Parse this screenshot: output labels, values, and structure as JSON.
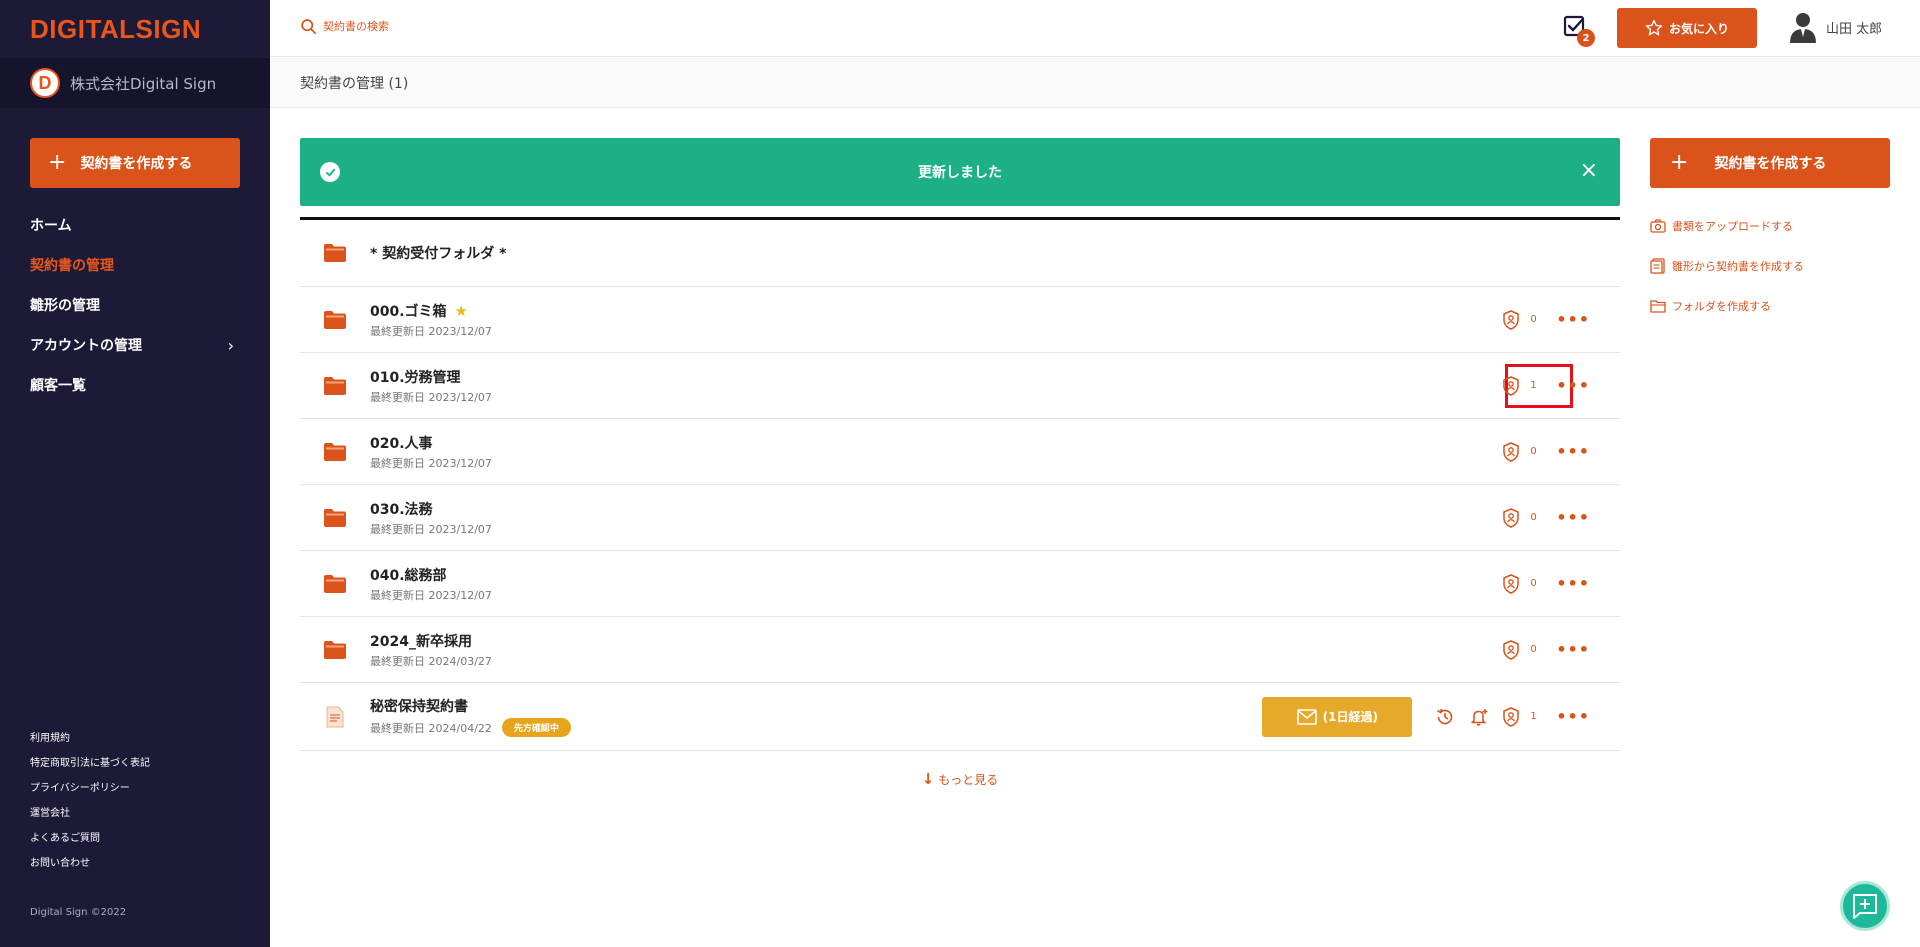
{
  "app": {
    "logo": "DIGITALSIGN",
    "company_initial": "D",
    "company_name": "株式会社Digital Sign",
    "brand_color": "#d9531a",
    "success_color": "#1db085"
  },
  "sidebar": {
    "create_label": "契約書を作成する",
    "items": [
      {
        "label": "ホーム"
      },
      {
        "label": "契約書の管理"
      },
      {
        "label": "雛形の管理"
      },
      {
        "label": "アカウントの管理"
      },
      {
        "label": "顧客一覧"
      }
    ],
    "footer_links": [
      {
        "label": "利用規約"
      },
      {
        "label": "特定商取引法に基づく表記"
      },
      {
        "label": "プライバシーポリシー"
      },
      {
        "label": "運営会社"
      },
      {
        "label": "よくあるご質問"
      },
      {
        "label": "お問い合わせ"
      }
    ],
    "copyright": "Digital Sign ©2022"
  },
  "topbar": {
    "search_placeholder": "契約書の検索",
    "task_count": "2",
    "favorites_label": "お気に入り",
    "user_name": "山田 太郎"
  },
  "breadcrumb": "契約書の管理 (1)",
  "alert": {
    "message": "更新しました",
    "close": "×"
  },
  "list": {
    "folders": [
      {
        "name": "* 契約受付フォルダ *"
      },
      {
        "name": "000.ゴミ箱",
        "starred": "★",
        "date": "最終更新日 2023/12/07",
        "count": "0"
      },
      {
        "name": "010.労務管理",
        "date": "最終更新日 2023/12/07",
        "count": "1"
      },
      {
        "name": "020.人事",
        "date": "最終更新日 2023/12/07",
        "count": "0"
      },
      {
        "name": "030.法務",
        "date": "最終更新日 2023/12/07",
        "count": "0"
      },
      {
        "name": "040.総務部",
        "date": "最終更新日 2023/12/07",
        "count": "0"
      },
      {
        "name": "2024_新卒採用",
        "date": "最終更新日 2024/03/27",
        "count": "0"
      }
    ],
    "document": {
      "name": "秘密保持契約書",
      "date": "最終更新日 2024/04/22",
      "status": "先方確認中",
      "mail_label": "(1日経過)",
      "count": "1"
    },
    "more_label": "もっと見る",
    "more_icon": "↓",
    "menu_glyph": "•••"
  },
  "right_panel": {
    "create_label": "契約書を作成する",
    "links": [
      {
        "label": "書類をアップロードする",
        "icon": "camera-icon"
      },
      {
        "label": "雛形から契約書を作成する",
        "icon": "template-icon"
      },
      {
        "label": "フォルダを作成する",
        "icon": "folder-icon"
      }
    ]
  }
}
